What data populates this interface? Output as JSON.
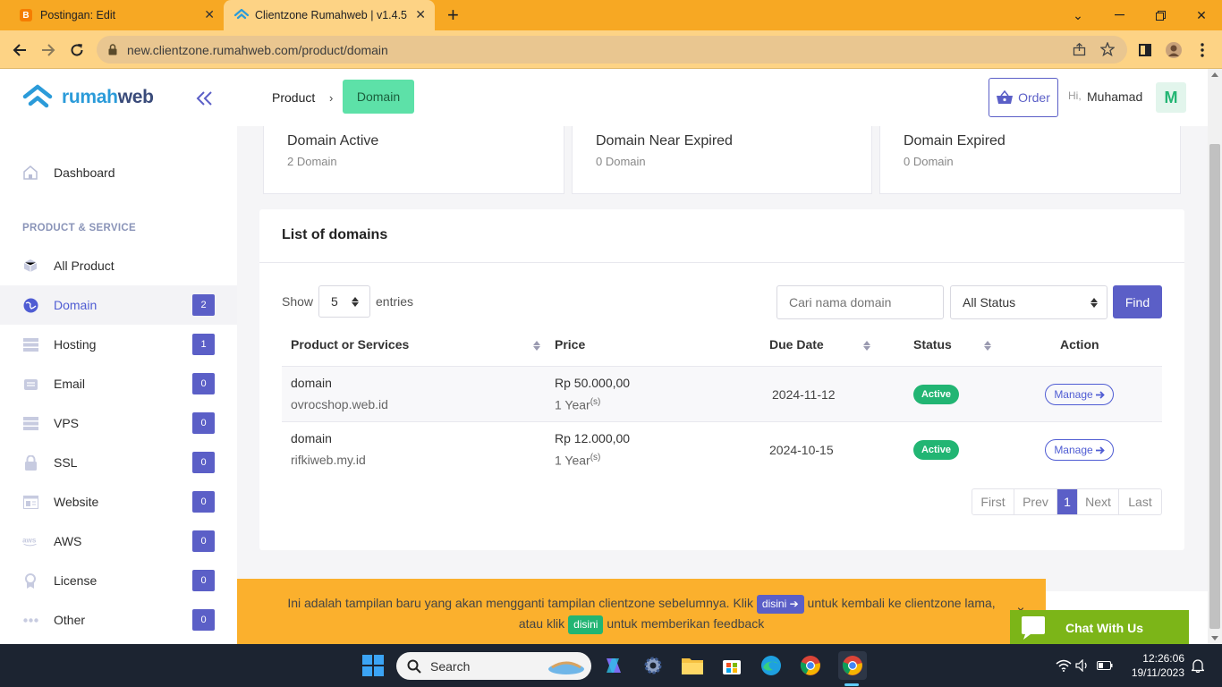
{
  "browser": {
    "tabs": [
      {
        "title": "Postingan: Edit",
        "active": false,
        "favicon_color": "#f57d00"
      },
      {
        "title": "Clientzone Rumahweb | v1.4.5",
        "active": true,
        "favicon_color": "#2b9bd9"
      }
    ],
    "url": "new.clientzone.rumahweb.com/product/domain"
  },
  "sidebar": {
    "logo_part1": "rumah",
    "logo_part2": "web",
    "dashboard_label": "Dashboard",
    "section_title": "PRODUCT & SERVICE",
    "items": [
      {
        "label": "All Product",
        "icon": "cube-icon",
        "badge": null,
        "active": false
      },
      {
        "label": "Domain",
        "icon": "globe-icon",
        "badge": "2",
        "active": true
      },
      {
        "label": "Hosting",
        "icon": "server-icon",
        "badge": "1",
        "active": false
      },
      {
        "label": "Email",
        "icon": "email-icon",
        "badge": "0",
        "active": false
      },
      {
        "label": "VPS",
        "icon": "vps-icon",
        "badge": "0",
        "active": false
      },
      {
        "label": "SSL",
        "icon": "lock-icon",
        "badge": "0",
        "active": false
      },
      {
        "label": "Website",
        "icon": "website-icon",
        "badge": "0",
        "active": false
      },
      {
        "label": "AWS",
        "icon": "aws-icon",
        "badge": "0",
        "active": false
      },
      {
        "label": "License",
        "icon": "license-icon",
        "badge": "0",
        "active": false
      },
      {
        "label": "Other",
        "icon": "dots-icon",
        "badge": "0",
        "active": false
      }
    ]
  },
  "header": {
    "breadcrumb_product": "Product",
    "breadcrumb_sep": "›",
    "breadcrumb_current": "Domain",
    "order_label": "Order",
    "hi": "Hi,",
    "user_name": "Muhamad",
    "avatar_initial": "M"
  },
  "stats": [
    {
      "title": "Domain Active",
      "value": "2 Domain"
    },
    {
      "title": "Domain Near Expired",
      "value": "0 Domain"
    },
    {
      "title": "Domain Expired",
      "value": "0 Domain"
    }
  ],
  "list": {
    "title": "List of domains",
    "show_label": "Show",
    "entries_value": "5",
    "entries_label": "entries",
    "search_placeholder": "Cari nama domain",
    "status_value": "All Status",
    "find_label": "Find",
    "columns": [
      "Product or Services",
      "Price",
      "Due Date",
      "Status",
      "Action"
    ],
    "rows": [
      {
        "product": "domain",
        "domain": "ovrocshop.web.id",
        "price": "Rp 50.000,00",
        "period": "1 Year",
        "period_sup": "(s)",
        "due": "2024-11-12",
        "status": "Active",
        "action": "Manage"
      },
      {
        "product": "domain",
        "domain": "rifkiweb.my.id",
        "price": "Rp 12.000,00",
        "period": "1 Year",
        "period_sup": "(s)",
        "due": "2024-10-15",
        "status": "Active",
        "action": "Manage"
      }
    ],
    "pagination": [
      "First",
      "Prev",
      "1",
      "Next",
      "Last"
    ]
  },
  "notice": {
    "text1": "Ini adalah tampilan baru yang akan mengganti tampilan clientzone sebelumnya. Klik",
    "link1": "disini",
    "text2": "untuk kembali ke clientzone lama,",
    "text3": "atau klik",
    "link2": "disini",
    "text4": "untuk memberikan feedback",
    "close": "×"
  },
  "chat_label": "Chat With Us",
  "taskbar": {
    "search_label": "Search",
    "time": "12:26:06",
    "date": "19/11/2023"
  },
  "colors": {
    "primary": "#5b5fc7",
    "success": "#22b573",
    "breadcrumb_active": "#5de1a8",
    "notice_bg": "#fbb02d",
    "chat_bg": "#7cb518",
    "browser_frame": "#f7a823"
  }
}
